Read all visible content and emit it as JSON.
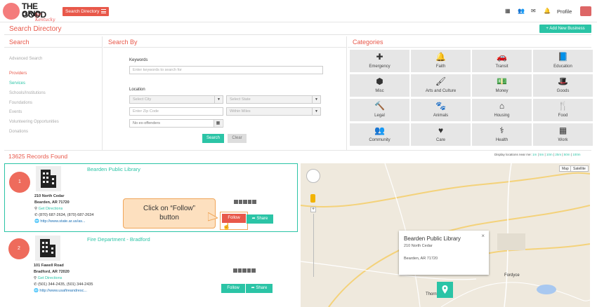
{
  "header": {
    "logo": {
      "line1": "THE GOOD",
      "line2": "GRID",
      "script": "for Kentucky"
    },
    "search_directory_label": "Search Directory",
    "profile_label": "Profile",
    "icons": [
      "grid-icon",
      "users-icon",
      "envelope-icon",
      "bell-icon"
    ]
  },
  "page": {
    "title": "Search Directory",
    "add_new_business": "+ Add New Business"
  },
  "search_panel": {
    "heading": "Search",
    "advanced_search": "Advanced Search",
    "items": [
      "Providers",
      "Services",
      "Schools/Institutions",
      "Foundations",
      "Events",
      "Volunteering Opportunities",
      "Donations"
    ],
    "selected": "Providers"
  },
  "search_by": {
    "heading": "Search By",
    "keywords_label": "Keywords",
    "keywords_placeholder": "Enter keywords to search for",
    "location_label": "Location",
    "city_placeholder": "Select City",
    "state_placeholder": "Select State",
    "zip_placeholder": "Enter Zip Code",
    "miles_placeholder": "Within Miles",
    "offenders_label": "No ex-offenders",
    "search_button": "Search",
    "clear_button": "Clear"
  },
  "categories": {
    "heading": "Categories",
    "items": [
      {
        "label": "Emergency",
        "icon": "medkit-icon",
        "glyph": "✚"
      },
      {
        "label": "Faith",
        "icon": "bell-icon",
        "glyph": "🔔"
      },
      {
        "label": "Transit",
        "icon": "car-icon",
        "glyph": "🚗"
      },
      {
        "label": "Education",
        "icon": "book-icon",
        "glyph": "📘"
      },
      {
        "label": "Misc",
        "icon": "cube-icon",
        "glyph": "⬢"
      },
      {
        "label": "Arts and Culture",
        "icon": "paintbrush-icon",
        "glyph": "🖌"
      },
      {
        "label": "Money",
        "icon": "money-icon",
        "glyph": "💵"
      },
      {
        "label": "Goods",
        "icon": "hat-icon",
        "glyph": "🎩"
      },
      {
        "label": "Legal",
        "icon": "gavel-icon",
        "glyph": "🔨"
      },
      {
        "label": "Animals",
        "icon": "paw-icon",
        "glyph": "🐾"
      },
      {
        "label": "Housing",
        "icon": "home-icon",
        "glyph": "⌂"
      },
      {
        "label": "Food",
        "icon": "cutlery-icon",
        "glyph": "🍴"
      },
      {
        "label": "Community",
        "icon": "users-icon",
        "glyph": "👥"
      },
      {
        "label": "Care",
        "icon": "heart-icon",
        "glyph": "♥"
      },
      {
        "label": "Health",
        "icon": "stethoscope-icon",
        "glyph": "⚕"
      },
      {
        "label": "Work",
        "icon": "building-icon",
        "glyph": "▦"
      }
    ]
  },
  "results": {
    "count_label": "13625 Records Found",
    "distance_prefix": "Display locations near me:",
    "distance_options": [
      "1m",
      "5m",
      "10m",
      "25m",
      "50m",
      "100m"
    ],
    "records": [
      {
        "num": "1",
        "name": "Bearden Public Library",
        "street": "210 North Cedar",
        "city": "Bearden, AR 71720",
        "directions": "Get Directions",
        "phone": "(870) 687-2634, (870) 687-2634",
        "url": "http://www.state.ar.us/as...",
        "follow": "Follow",
        "share": "Share"
      },
      {
        "num": "2",
        "name": "Fire Department - Bradford",
        "street": "101 Fawell Road",
        "city": "Bradford, AR 72020",
        "directions": "Get Directions",
        "phone": "(501) 344-2435, (501) 344-2435",
        "url": "http://www.usafireandresc...",
        "follow": "Follow",
        "share": "Share"
      }
    ]
  },
  "callout": {
    "line1": "Click on “Follow”",
    "line2": "button"
  },
  "map": {
    "map_label": "Map",
    "satellite_label": "Satellite",
    "info_title": "Bearden Public Library",
    "info_street": "210 North Cedar",
    "info_city": "Bearden, AR 71720",
    "town_label": "Fordyce",
    "town2_label": "Thornt"
  }
}
